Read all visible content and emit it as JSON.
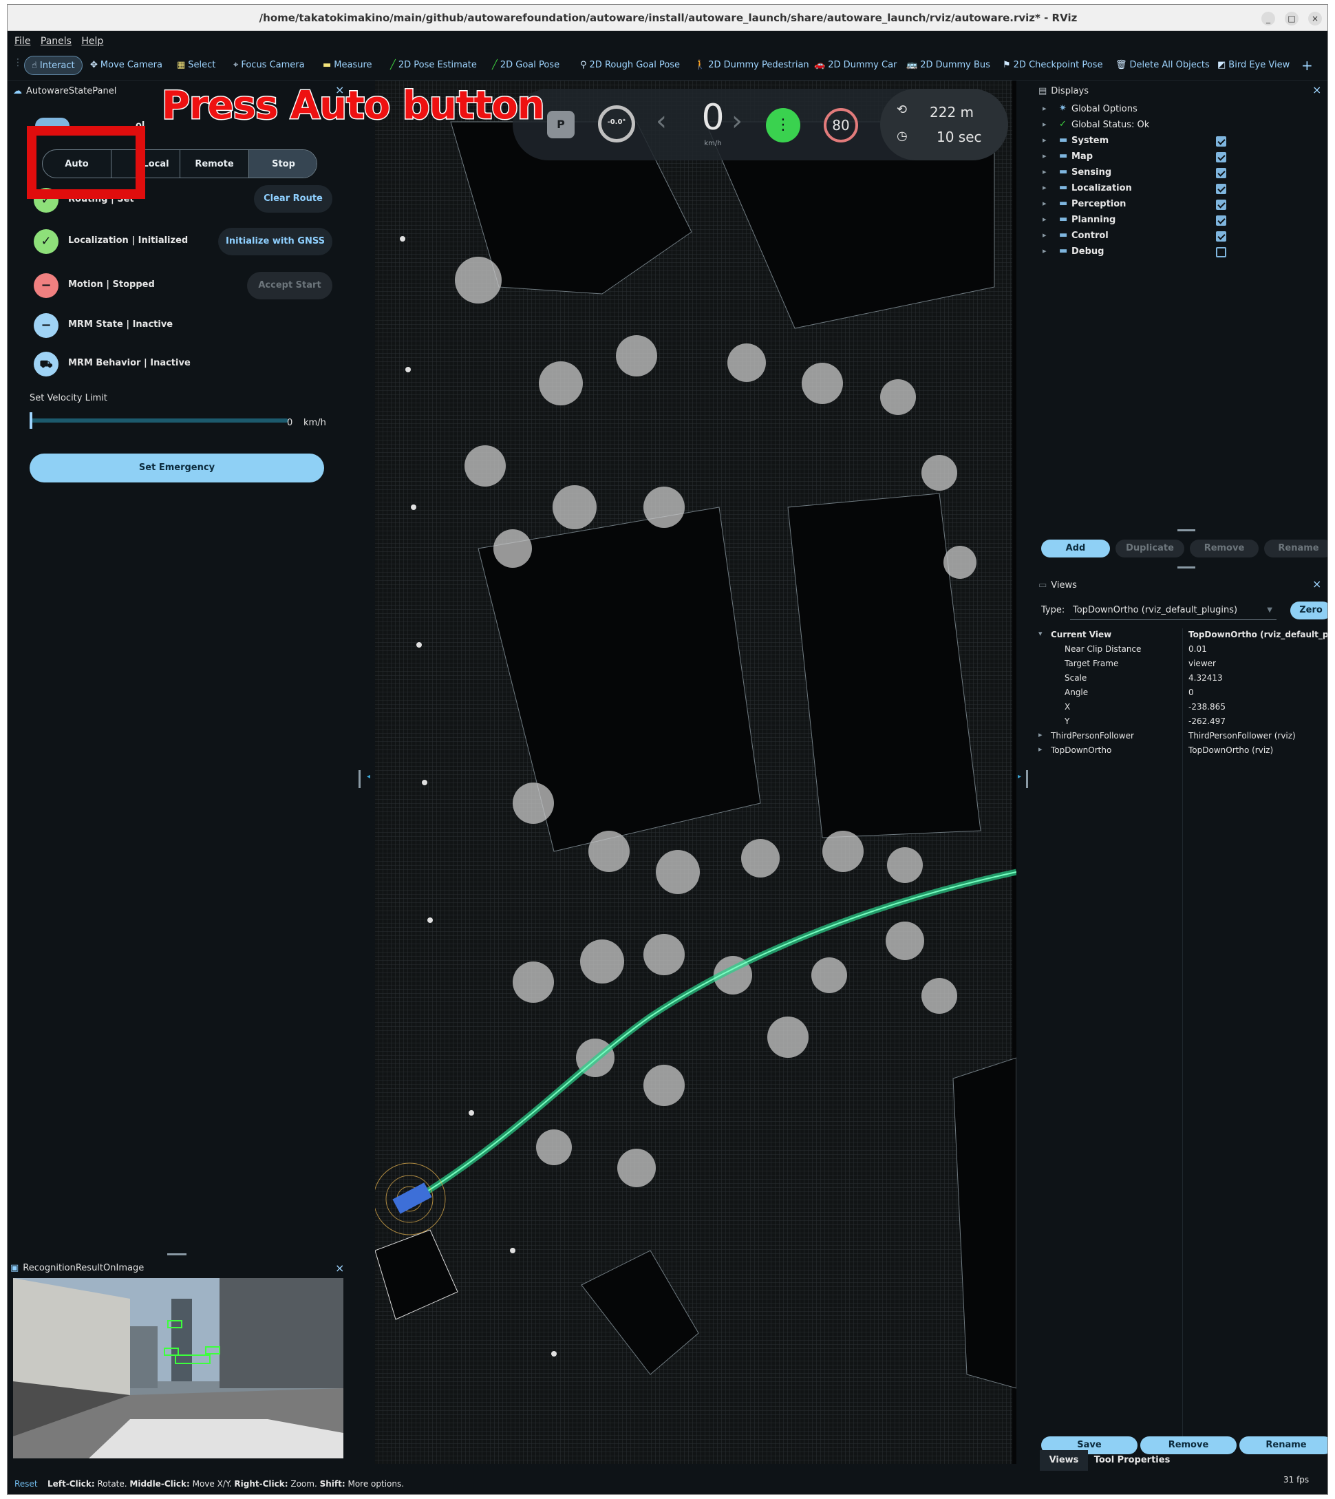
{
  "window": {
    "title": "/home/takatokimakino/main/github/autowarefoundation/autoware/install/autoware_launch/share/autoware_launch/rviz/autoware.rviz* - RViz",
    "minimize": "_",
    "maximize": "□",
    "close": "×"
  },
  "menu": {
    "file": "File",
    "panels": "Panels",
    "help": "Help"
  },
  "toolbar": {
    "interact": "Interact",
    "move_camera": "Move Camera",
    "select": "Select",
    "focus_camera": "Focus Camera",
    "measure": "Measure",
    "pose_estimate": "2D Pose Estimate",
    "goal_pose": "2D Goal Pose",
    "rough_goal_pose": "2D Rough Goal Pose",
    "dummy_pedestrian": "2D Dummy Pedestrian",
    "dummy_car": "2D Dummy Car",
    "dummy_bus": "2D Dummy Bus",
    "checkpoint_pose": "2D Checkpoint Pose",
    "delete_all": "Delete All Objects",
    "bird_eye": "Bird Eye View",
    "add": "+"
  },
  "annotation": {
    "text": "Press Auto button",
    "color": "#e00d0d"
  },
  "state_panel": {
    "title": "AutowareStatePanel",
    "control_label": "ol",
    "modes": [
      "Auto",
      "Local",
      "Remote",
      "Stop"
    ],
    "routing": {
      "label": "Routing | Set",
      "button": "Clear Route"
    },
    "localization": {
      "label": "Localization | Initialized",
      "button": "Initialize with GNSS"
    },
    "motion": {
      "label": "Motion | Stopped",
      "button": "Accept Start"
    },
    "mrm_state": {
      "label": "MRM State | Inactive"
    },
    "mrm_behavior": {
      "label": "MRM Behavior | Inactive"
    },
    "velocity": {
      "title": "Set Velocity Limit",
      "value": "0",
      "unit": "km/h",
      "level": 0
    },
    "emergency_button": "Set Emergency",
    "colors": {
      "ok": "#8ee07a",
      "error": "#f08080",
      "info": "#9fd3f5"
    }
  },
  "recognition": {
    "title": "RecognitionResultOnImage"
  },
  "hud": {
    "gear": "P",
    "steering": "-0.0°",
    "speed": "0",
    "speed_unit": "km/h",
    "speed_limit": "80",
    "distance": "222 m",
    "time": "10 sec"
  },
  "displays": {
    "title": "Displays",
    "items": [
      {
        "label": "Global Options",
        "checked": null
      },
      {
        "label": "Global Status: Ok",
        "checked": null
      },
      {
        "label": "System",
        "checked": true
      },
      {
        "label": "Map",
        "checked": true
      },
      {
        "label": "Sensing",
        "checked": true
      },
      {
        "label": "Localization",
        "checked": true
      },
      {
        "label": "Perception",
        "checked": true
      },
      {
        "label": "Planning",
        "checked": true
      },
      {
        "label": "Control",
        "checked": true
      },
      {
        "label": "Debug",
        "checked": false
      }
    ],
    "buttons": {
      "add": "Add",
      "duplicate": "Duplicate",
      "remove": "Remove",
      "rename": "Rename"
    }
  },
  "views": {
    "title": "Views",
    "type_label": "Type:",
    "type_value": "TopDownOrtho (rviz_default_plugins)",
    "zero": "Zero",
    "current_view": {
      "name": "Current View",
      "value": "TopDownOrtho (rviz_default_plug..."
    },
    "props": [
      {
        "name": "Near Clip Distance",
        "value": "0.01"
      },
      {
        "name": "Target Frame",
        "value": "viewer"
      },
      {
        "name": "Scale",
        "value": "4.32413"
      },
      {
        "name": "Angle",
        "value": "0"
      },
      {
        "name": "X",
        "value": "-238.865"
      },
      {
        "name": "Y",
        "value": "-262.497"
      }
    ],
    "saved": [
      {
        "name": "ThirdPersonFollower",
        "value": "ThirdPersonFollower (rviz)"
      },
      {
        "name": "TopDownOrtho",
        "value": "TopDownOrtho (rviz)"
      }
    ],
    "buttons": {
      "save": "Save",
      "remove": "Remove",
      "rename": "Rename"
    },
    "tabs": {
      "views": "Views",
      "tool_properties": "Tool Properties"
    }
  },
  "statusbar": {
    "reset": "Reset",
    "left_click": "Left-Click:",
    "left_desc": " Rotate. ",
    "middle_click": "Middle-Click:",
    "middle_desc": " Move X/Y. ",
    "right_click": "Right-Click:",
    "right_desc": " Zoom. ",
    "shift": "Shift:",
    "shift_desc": " More options.",
    "fps": "31 fps"
  }
}
